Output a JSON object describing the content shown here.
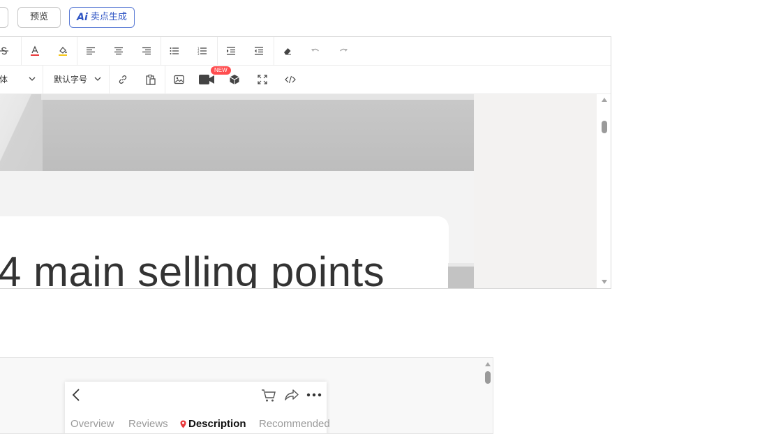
{
  "top_actions": {
    "preview_label": "预览",
    "ai_mark": "Ai",
    "ai_label": "卖点生成"
  },
  "toolbar": {
    "row1": {
      "strikethrough_icon": "strikethrough-icon",
      "font_color_icon": "font-color-icon",
      "background_color_icon": "highlight-color-icon",
      "align_left_icon": "align-left-icon",
      "align_center_icon": "align-center-icon",
      "align_right_icon": "align-right-icon",
      "bullet_list_icon": "bullet-list-icon",
      "numbered_list_icon": "numbered-list-icon",
      "indent_icon": "indent-icon",
      "outdent_icon": "outdent-icon",
      "clear_format_icon": "eraser-icon",
      "undo_icon": "undo-icon",
      "redo_icon": "redo-icon"
    },
    "row2": {
      "font_family_value": "体",
      "font_size_value": "默认字号",
      "new_badge": "NEW"
    }
  },
  "content": {
    "headline": "4 main selling points"
  },
  "phone_preview": {
    "tabs": [
      "Overview",
      "Reviews",
      "Description",
      "Recommended"
    ],
    "active_tab_index": 2
  },
  "colors": {
    "accent_blue": "#2f55c4",
    "badge_red": "#ff4d4f",
    "pin_red": "#e8393b"
  }
}
